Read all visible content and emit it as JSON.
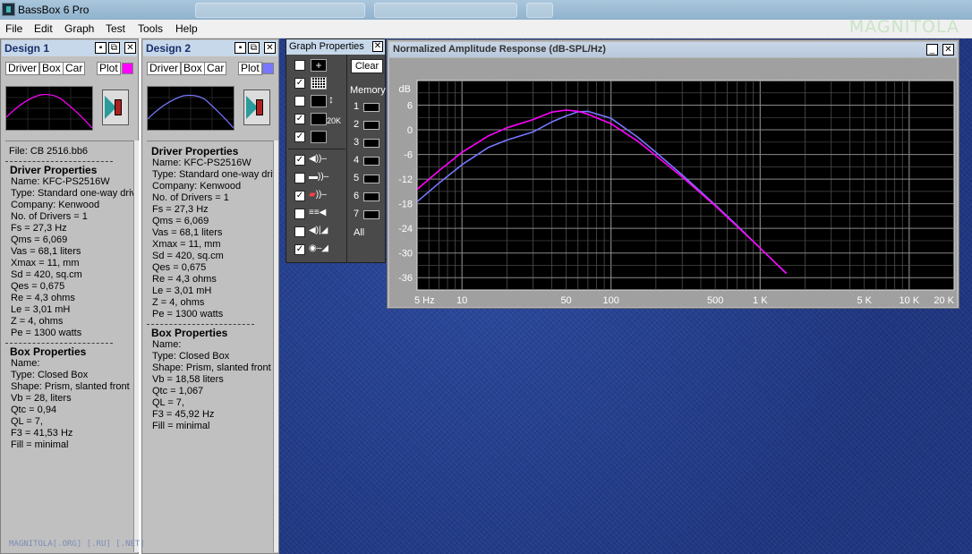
{
  "app": {
    "title": "BassBox 6 Pro",
    "watermark": "MAGNITOLA"
  },
  "menu": [
    "File",
    "Edit",
    "Graph",
    "Test",
    "Tools",
    "Help"
  ],
  "designs": [
    {
      "title": "Design 1",
      "buttons": [
        "Driver",
        "Box",
        "Car",
        "Plot"
      ],
      "plot_color": "#ff00ff",
      "file": "File:  CB 2516.bb6",
      "driver_header": "Driver Properties",
      "driver": [
        "Name:  KFC-PS2516W",
        "Type:  Standard one-way driver",
        "Company:  Kenwood",
        "No. of Drivers = 1",
        "Fs =  27,3 Hz",
        "Qms =  6,069",
        "Vas =  68,1 liters",
        "Xmax =  11, mm",
        "Sd =  420, sq.cm",
        "Qes =  0,675",
        "Re =  4,3 ohms",
        "Le =  3,01 mH",
        "Z =  4, ohms",
        "Pe =  1300 watts"
      ],
      "box_header": "Box Properties",
      "box": [
        "Name:",
        "Type:  Closed Box",
        "Shape:  Prism, slanted front",
        "Vb =  28, liters",
        "Qtc =  0,94",
        "QL =  7,",
        "F3 =  41,53 Hz",
        "Fill = minimal"
      ]
    },
    {
      "title": "Design 2",
      "buttons": [
        "Driver",
        "Box",
        "Car",
        "Plot"
      ],
      "plot_color": "#7777ff",
      "driver_header": "Driver Properties",
      "driver": [
        "Name:  KFC-PS2516W",
        "Type:  Standard one-way driver",
        "Company:  Kenwood",
        "No. of Drivers = 1",
        "Fs =  27,3 Hz",
        "Qms =  6,069",
        "Vas =  68,1 liters",
        "Xmax =  11, mm",
        "Sd =  420, sq.cm",
        "Qes =  0,675",
        "Re =  4,3 ohms",
        "Le =  3,01 mH",
        "Z =  4, ohms",
        "Pe =  1300 watts"
      ],
      "box_header": "Box Properties",
      "box": [
        "Name:",
        "Type:  Closed Box",
        "Shape:  Prism, slanted front",
        "Vb =  18,58 liters",
        "Qtc =  1,067",
        "QL =  7,",
        "F3 =  45,92 Hz",
        "Fill = minimal"
      ]
    }
  ],
  "graph_properties": {
    "title": "Graph Properties",
    "clear_label": "Clear",
    "memory_label": "Memory",
    "memory_slots": [
      "1",
      "2",
      "3",
      "4",
      "5",
      "6",
      "7"
    ],
    "all_label": "All",
    "checkboxes": [
      false,
      true,
      false,
      true,
      true,
      true,
      false,
      true,
      false,
      false,
      true
    ],
    "zoom_label": "20K"
  },
  "graph": {
    "title": "Normalized Amplitude Response (dB-SPL/Hz)",
    "y_unit": "dB",
    "y_ticks": [
      "6",
      "0",
      "-6",
      "-12",
      "-18",
      "-24",
      "-30",
      "-36"
    ],
    "x_ticks": [
      "5 Hz",
      "10",
      "50",
      "100",
      "500",
      "1 K",
      "5 K",
      "10 K",
      "20 K"
    ]
  },
  "footer_watermark": "MAGNITOLA[.ORG] [.RU] [.NET]",
  "chart_data": {
    "type": "line",
    "title": "Normalized Amplitude Response (dB-SPL/Hz)",
    "xlabel": "",
    "ylabel": "dB",
    "x_scale": "log",
    "xlim": [
      5,
      20000
    ],
    "ylim": [
      -39,
      12
    ],
    "grid": true,
    "series": [
      {
        "color": "#ff00ff",
        "x": [
          5,
          7,
          10,
          15,
          20,
          30,
          40,
          50,
          60,
          70,
          100,
          150,
          200,
          300,
          500,
          700,
          1000,
          1500
        ],
        "y": [
          -14.5,
          -10,
          -5.5,
          -1.5,
          0.5,
          2.5,
          4.3,
          4.8,
          4.5,
          3.8,
          1.5,
          -2.7,
          -6.3,
          -11.5,
          -18.5,
          -23.5,
          -28.8,
          -35
        ]
      },
      {
        "color": "#7777ff",
        "x": [
          5,
          7,
          10,
          15,
          20,
          30,
          40,
          50,
          60,
          70,
          100,
          150,
          200,
          300,
          500,
          700,
          1000,
          1500
        ],
        "y": [
          -17.5,
          -13,
          -8.5,
          -4.3,
          -2.5,
          -0.5,
          1.9,
          3.4,
          4.4,
          4.5,
          2.8,
          -1.7,
          -5.5,
          -11,
          -18.3,
          -23.3,
          -28.8,
          -35
        ]
      }
    ]
  }
}
